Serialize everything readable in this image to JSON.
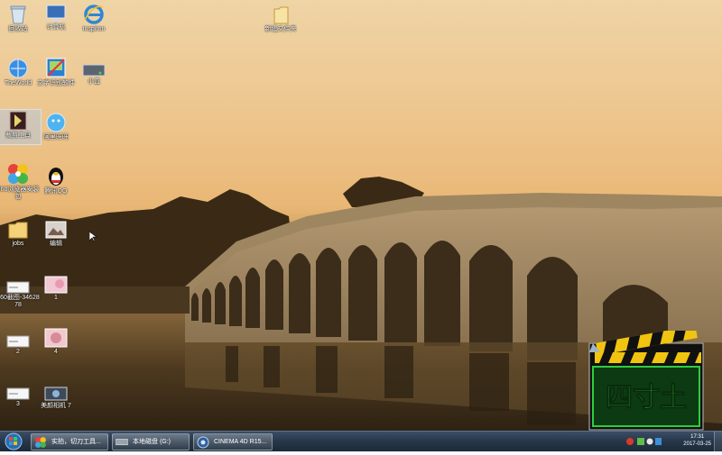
{
  "desktop": {
    "icons": [
      {
        "label": "回收站",
        "icon": "recycle-bin-icon"
      },
      {
        "label": "计算机",
        "icon": "computer-icon"
      },
      {
        "label": "Inspiron",
        "icon": "internet-explorer-icon"
      },
      {
        "label": "新建文件夹",
        "icon": "folder-icon"
      },
      {
        "label": "TheWorld",
        "icon": "theworld-browser-icon"
      },
      {
        "label": "文字识别软件",
        "icon": "ocr-app-icon"
      },
      {
        "label": "小盒",
        "icon": "drive-icon"
      },
      {
        "label": "裁剪工具",
        "icon": "cutting-tool-icon"
      },
      {
        "label": "阿里旺旺",
        "icon": "aliwangwang-icon"
      },
      {
        "label": "360浏览器安装包",
        "icon": "pinwheel-app-icon"
      },
      {
        "label": "腾讯QQ",
        "icon": "qq-penguin-icon"
      },
      {
        "label": "jobs",
        "icon": "folder-icon"
      },
      {
        "label": "编辑",
        "icon": "picture-app-icon"
      },
      {
        "label": "360截图-3462878",
        "icon": "image-file-icon"
      },
      {
        "label": "1",
        "icon": "image-file-icon"
      },
      {
        "label": "2",
        "icon": "image-file-icon"
      },
      {
        "label": "4",
        "icon": "image-file-icon"
      },
      {
        "label": "3",
        "icon": "image-file-icon"
      },
      {
        "label": "美颜相机 7",
        "icon": "camera-app-icon"
      }
    ]
  },
  "logo": {
    "text": "四寸土"
  },
  "taskbar": {
    "start_icon": "windows-start-icon",
    "tasks": [
      {
        "label": "实拍，切刀工具...",
        "icon": "pinwheel-app-icon"
      },
      {
        "label": "本地磁盘 (G:)",
        "icon": "drive-icon"
      },
      {
        "label": "CINEMA 4D R15...",
        "icon": "cinema4d-icon"
      }
    ],
    "clock_time": "17:31",
    "clock_date": "2017-03-25"
  },
  "colors": {
    "taskbar": "#273749",
    "accent": "#f1c40f",
    "logo_green": "#2ecc40"
  }
}
